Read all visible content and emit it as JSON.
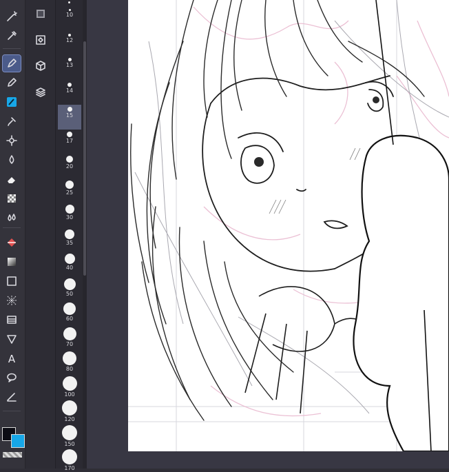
{
  "tools": [
    {
      "name": "magic-wand-icon",
      "icon": "wand"
    },
    {
      "name": "eyedropper-icon",
      "icon": "dropper"
    },
    {
      "name": "pen-icon",
      "icon": "pen",
      "active": true
    },
    {
      "name": "pencil-icon",
      "icon": "pencil"
    },
    {
      "name": "brush-icon",
      "icon": "brush"
    },
    {
      "name": "airbrush-icon",
      "icon": "airbrush"
    },
    {
      "name": "decoration-icon",
      "icon": "decoration"
    },
    {
      "name": "blend-icon",
      "icon": "blend"
    },
    {
      "name": "eraser-icon",
      "icon": "eraser"
    },
    {
      "name": "transparent-brush-icon",
      "icon": "checker"
    },
    {
      "name": "water-drops-icon",
      "icon": "drops"
    },
    {
      "name": "fill-icon",
      "icon": "fill"
    },
    {
      "name": "gradient-icon",
      "icon": "gradient"
    },
    {
      "name": "figure-icon",
      "icon": "square"
    },
    {
      "name": "frame-border-icon",
      "icon": "frame"
    },
    {
      "name": "ruler-icon",
      "icon": "ruler"
    },
    {
      "name": "vector-operation-icon",
      "icon": "vector"
    },
    {
      "name": "text-icon",
      "icon": "text"
    },
    {
      "name": "balloon-icon",
      "icon": "balloon"
    },
    {
      "name": "correct-line-icon",
      "icon": "correct"
    }
  ],
  "text_tool_glyph": "A",
  "subtools": [
    {
      "name": "layer-icon",
      "icon": "layer"
    },
    {
      "name": "material-folder-icon",
      "icon": "folder"
    },
    {
      "name": "3d-object-icon",
      "icon": "cube"
    },
    {
      "name": "layer-stack-icon",
      "icon": "stack"
    }
  ],
  "brush_sizes": [
    "10",
    "12",
    "13",
    "14",
    "15",
    "17",
    "20",
    "25",
    "30",
    "35",
    "40",
    "50",
    "60",
    "70",
    "80",
    "100",
    "120",
    "150",
    "170"
  ],
  "selected_brush_size": "15",
  "colors": {
    "main": "#0c0c14",
    "sub": "#17a7e8",
    "active_tool_bg": "#4b5b8a",
    "canvas_bg": "#383743",
    "sketch_pink": "#e9b9cf"
  }
}
